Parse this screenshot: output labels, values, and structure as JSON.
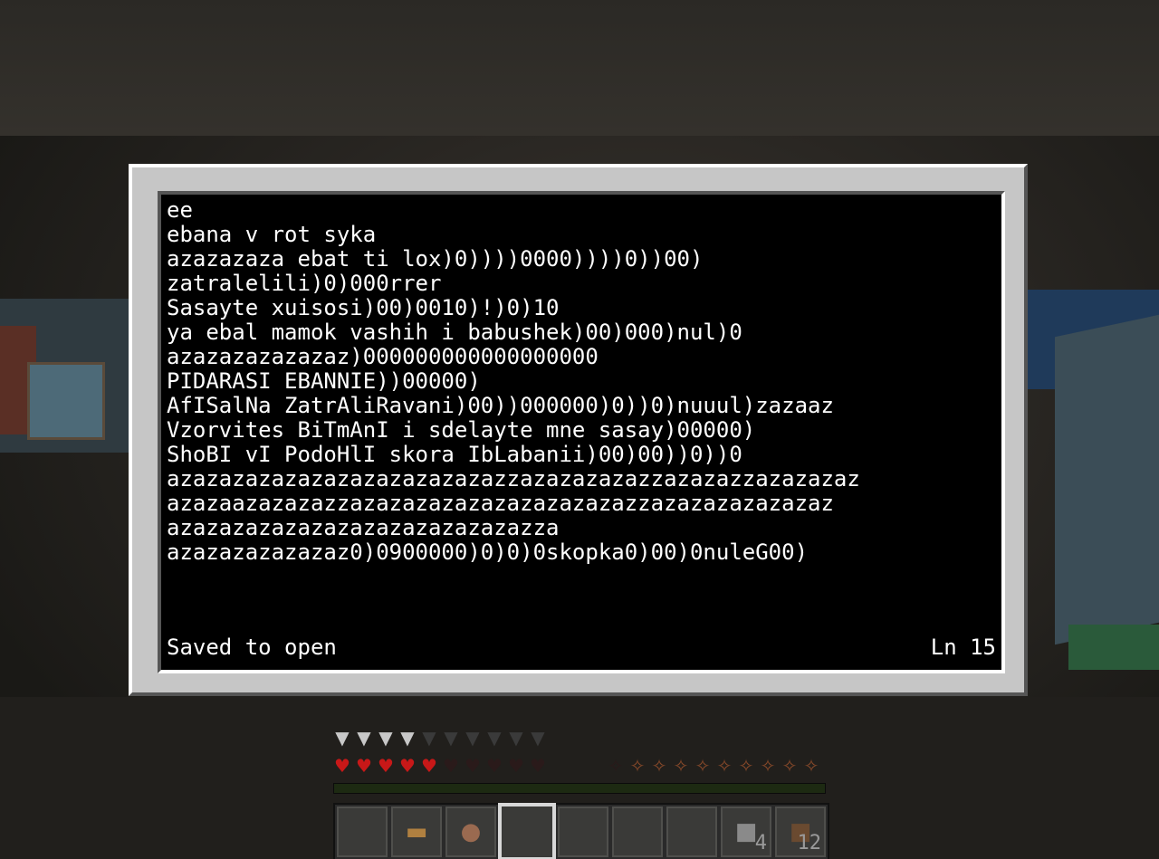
{
  "terminal": {
    "lines": [
      "ee",
      "ebana v rot syka",
      "azazazaza ebat ti lox)0))))0000))))0))00)",
      "zatralelili)0)000rrer",
      "Sasayte xuisosi)00)0010)!)0)10",
      "ya ebal mamok vashih i babushek)00)000)nul)0",
      "azazazazazazaz)000000000000000000",
      "PIDARASI EBANNIE))00000)",
      "AfISalNa ZatrAliRavani)00))000000)0))0)nuuul)zazaaz",
      "Vzorvites BiTmAnI i sdelayte mne sasay)00000)",
      "ShoBI vI PodoHlI skora IbLabanii)00)00))0))0",
      "azazazazazazazazazazazazazzazazazazazzazazazzazazazaz",
      "azazaazazazazzazazazazazazazazazazazzazazazazazazaz",
      "azazazazazazazazazazazazazazza",
      "azazazazazazaz0)0900000)0)0)0skopka0)00)0nuleG00)"
    ],
    "status_left": "Saved to open",
    "status_right": "Ln 15"
  },
  "hud": {
    "armor": {
      "full": 4,
      "total": 10,
      "icon": "chestplate-icon"
    },
    "health": {
      "full": 5,
      "total": 10,
      "icon": "heart-icon"
    },
    "hunger": {
      "full": 9,
      "total": 10,
      "icon": "drumstick-icon"
    },
    "xp_fraction": 0.0,
    "hotbar": {
      "selected_index": 3,
      "slots": [
        {
          "item": "",
          "count": ""
        },
        {
          "item": "bread-icon",
          "count": ""
        },
        {
          "item": "porkchop-icon",
          "count": ""
        },
        {
          "item": "",
          "count": ""
        },
        {
          "item": "",
          "count": ""
        },
        {
          "item": "",
          "count": ""
        },
        {
          "item": "",
          "count": ""
        },
        {
          "item": "stone-block-icon",
          "count": "4"
        },
        {
          "item": "dirt-block-icon",
          "count": "12"
        }
      ]
    }
  },
  "colors": {
    "terminal_bg": "#000000",
    "terminal_text": "#ffffff",
    "frame": "#c6c6c6",
    "heart": "#c81818",
    "armor": "#c8c8c8"
  }
}
